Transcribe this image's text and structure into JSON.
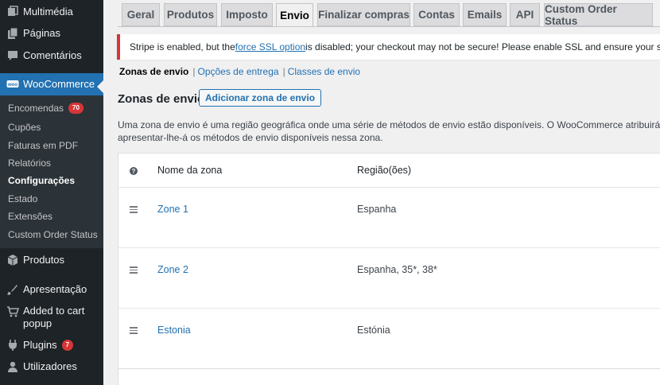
{
  "sidebar": {
    "items": [
      {
        "label": "Multimédia",
        "icon": "media-icon"
      },
      {
        "label": "Páginas",
        "icon": "pages-icon"
      },
      {
        "label": "Comentários",
        "icon": "comments-icon"
      },
      {
        "label": "WooCommerce",
        "icon": "woocommerce-icon"
      },
      {
        "label": "Produtos",
        "icon": "products-icon"
      },
      {
        "label": "Apresentação",
        "icon": "appearance-icon"
      },
      {
        "label": "Added to cart popup",
        "icon": "cart-icon"
      },
      {
        "label": "Plugins",
        "icon": "plugins-icon",
        "badge": "7"
      },
      {
        "label": "Utilizadores",
        "icon": "users-icon"
      }
    ],
    "submenu": [
      {
        "label": "Encomendas",
        "badge": "70"
      },
      {
        "label": "Cupões"
      },
      {
        "label": "Faturas em PDF"
      },
      {
        "label": "Relatórios"
      },
      {
        "label": "Configurações",
        "current": true
      },
      {
        "label": "Estado"
      },
      {
        "label": "Extensões"
      },
      {
        "label": "Custom Order Status"
      }
    ]
  },
  "tabs": [
    "Geral",
    "Produtos",
    "Imposto",
    "Envio",
    "Finalizar compras",
    "Contas",
    "Emails",
    "API",
    "Custom Order Status"
  ],
  "active_tab": "Envio",
  "notice": {
    "before": "Stripe is enabled, but the ",
    "link": "force SSL option",
    "after": " is disabled; your checkout may not be secure! Please enable SSL and ensure your server has a"
  },
  "subsubsub": {
    "current": "Zonas de envio",
    "links": [
      "Opções de entrega",
      "Classes de envio"
    ],
    "separator": "|"
  },
  "heading": "Zonas de envio",
  "add_button": "Adicionar zona de envio",
  "description": {
    "line1": "Uma zona de envio é uma região geográfica onde uma série de métodos de envio estão disponíveis. O WooCommerce atribuirá um cliente a",
    "line2": "apresentar-lhe-á os métodos de envio disponíveis nessa zona."
  },
  "table": {
    "help_glyph": "?",
    "headers": {
      "name": "Nome da zona",
      "regions": "Região(ões)"
    },
    "rows": [
      {
        "name": "Zone 1",
        "regions": "Espanha"
      },
      {
        "name": "Zone 2",
        "regions": "Espanha, 35*, 38*"
      },
      {
        "name": "Estonia",
        "regions": "Estónia"
      }
    ]
  },
  "colors": {
    "sidebar_bg": "#1d2327",
    "submenu_bg": "#2c3338",
    "accent": "#2271b1",
    "badge": "#d63638",
    "notice_border": "#d63638"
  }
}
